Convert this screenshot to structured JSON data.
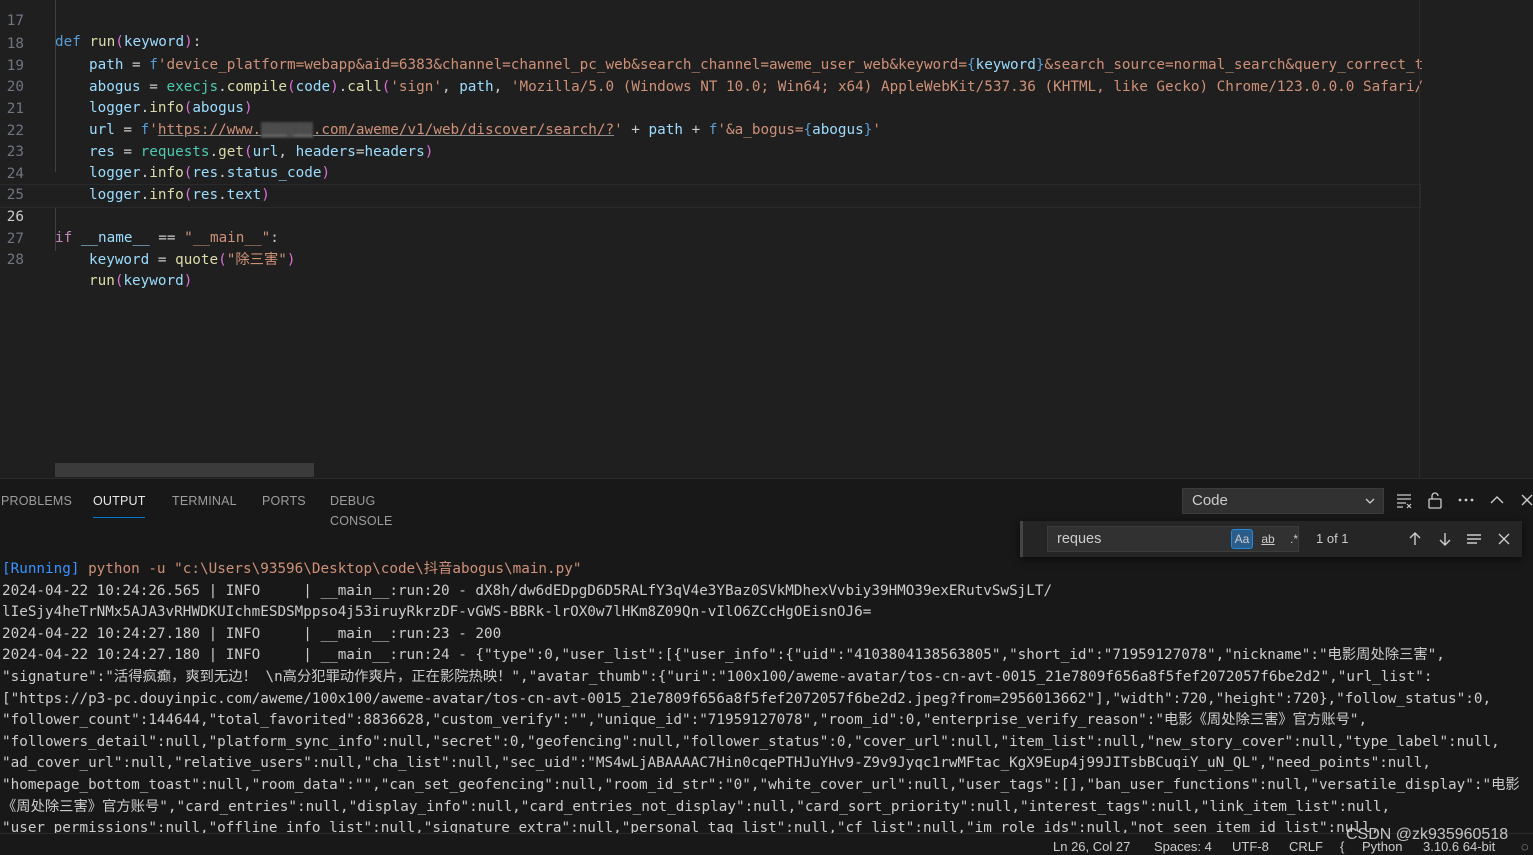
{
  "editor": {
    "lines": [
      {
        "n": "17",
        "code": "def run(keyword):"
      },
      {
        "n": "18",
        "code": "path = f'device_platform=webapp&aid=6383&channel=channel_pc_web&search_channel=aweme_user_web&keyword={keyword}&search_source=normal_search&query_correct_t"
      },
      {
        "n": "19",
        "code": "abogus = execjs.compile(code).call('sign', path, 'Mozilla/5.0 (Windows NT 10.0; Win64; x64) AppleWebKit/537.36 (KHTML, like Gecko) Chrome/123.0.0.0 Safari/"
      },
      {
        "n": "20",
        "code": "logger.info(abogus)"
      },
      {
        "n": "21",
        "url_prefix": "https://www.",
        "url_blur": "douyin",
        "url_suffix": ".com/aweme/v1/web/discover/search/?",
        "code_tail": " + path + f'&a_bogus={abogus}'"
      },
      {
        "n": "22",
        "code": "res = requests.get(url, headers=headers)"
      },
      {
        "n": "23",
        "code": "logger.info(res.status_code)"
      },
      {
        "n": "24",
        "code": "logger.info(res.text)"
      },
      {
        "n": "25",
        "code": ""
      },
      {
        "n": "26",
        "code": "if __name__ == \"__main__\":"
      },
      {
        "n": "27",
        "code": "keyword = quote(\"除三害\")"
      },
      {
        "n": "28",
        "code": "run(keyword)"
      }
    ]
  },
  "panel": {
    "tabs": [
      {
        "label": "PROBLEMS"
      },
      {
        "label": "OUTPUT"
      },
      {
        "label": "TERMINAL"
      },
      {
        "label": "PORTS"
      },
      {
        "label": "DEBUG CONSOLE"
      }
    ],
    "active_tab": "OUTPUT",
    "output_channel": "Code",
    "find": {
      "value": "reques",
      "match_case": "Aa",
      "whole_word": "ab",
      "regex": ".*",
      "count": "1 of 1"
    },
    "output_lines": [
      {
        "tag": "[Running]",
        "text": " python -u \"c:\\Users\\93596\\Desktop\\code\\抖音abogus\\main.py\""
      },
      {
        "text": "2024-04-22 10:24:26.565 | INFO     | __main__:run:20 - dX8h/dw6dEDpgD6D5RALfY3qV4e3YBaz0SVkMDhexVvbiy39HMO39exERutvSwSjLT/"
      },
      {
        "text": "lIeSjy4heTrNMx5AJA3vRHWDKUIchmESDSMppso4j53iruyRkrzDF-vGWS-BBRk-lrOX0w7lHKm8Z09Qn-vIlO6ZCcHgOEisnOJ6="
      },
      {
        "text": "2024-04-22 10:24:27.180 | INFO     | __main__:run:23 - 200"
      },
      {
        "text": "2024-04-22 10:24:27.180 | INFO     | __main__:run:24 - {\"type\":0,\"user_list\":[{\"user_info\":{\"uid\":\"4103804138563805\",\"short_id\":\"71959127078\",\"nickname\":\"电影周处除三害\","
      },
      {
        "text": "\"signature\":\"活得疯癫，爽到无边！ \\n高分犯罪动作爽片，正在影院热映！\",\"avatar_thumb\":{\"uri\":\"100x100/aweme-avatar/tos-cn-avt-0015_21e7809f656a8f5fef2072057f6be2d2\",\"url_list\":"
      },
      {
        "text": "[\"https://p3-pc.douyinpic.com/aweme/100x100/aweme-avatar/tos-cn-avt-0015_21e7809f656a8f5fef2072057f6be2d2.jpeg?from=2956013662\"],\"width\":720,\"height\":720},\"follow_status\":0,"
      },
      {
        "text": "\"follower_count\":144644,\"total_favorited\":8836628,\"custom_verify\":\"\",\"unique_id\":\"71959127078\",\"room_id\":0,\"enterprise_verify_reason\":\"电影《周处除三害》官方账号\","
      },
      {
        "text": "\"followers_detail\":null,\"platform_sync_info\":null,\"secret\":0,\"geofencing\":null,\"follower_status\":0,\"cover_url\":null,\"item_list\":null,\"new_story_cover\":null,\"type_label\":null,"
      },
      {
        "text": "\"ad_cover_url\":null,\"relative_users\":null,\"cha_list\":null,\"sec_uid\":\"MS4wLjABAAAAC7Hin0cqePTHJuYHv9-Z9v9Jyqc1rwMFtac_KgX9Eup4j99JITsbBCuqiY_uN_QL\",\"need_points\":null,"
      },
      {
        "text": "\"homepage_bottom_toast\":null,\"room_data\":\"\",\"can_set_geofencing\":null,\"room_id_str\":\"0\",\"white_cover_url\":null,\"user_tags\":[],\"ban_user_functions\":null,\"versatile_display\":\"电影"
      },
      {
        "text": "《周处除三害》官方账号\",\"card_entries\":null,\"display_info\":null,\"card_entries_not_display\":null,\"card_sort_priority\":null,\"interest_tags\":null,\"link_item_list\":null,"
      },
      {
        "text": "\"user_permissions\":null,\"offline_info_list\":null,\"signature_extra\":null,\"personal_tag_list\":null,\"cf_list\":null,\"im_role_ids\":null,\"not_seen_item_id_list\":null,"
      }
    ]
  },
  "status": {
    "position": "Ln 26, Col 27",
    "spaces": "Spaces: 4",
    "encoding": "UTF-8",
    "eol": "CRLF",
    "language": "Python",
    "interpreter": "3.10.6 64-bit"
  },
  "watermark": "CSDN @zk935960518",
  "colors": {
    "accent": "#0078d4",
    "editor_bg": "#1f1f1f",
    "panel_bg": "#181818"
  }
}
